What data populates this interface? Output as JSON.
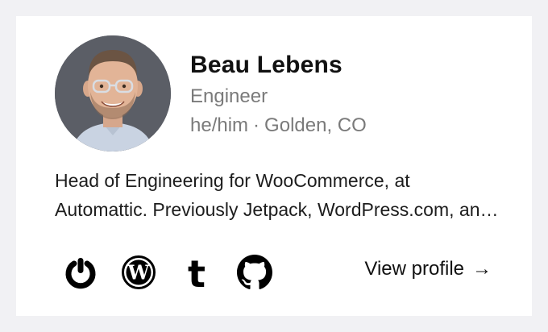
{
  "profile": {
    "name": "Beau Lebens",
    "title": "Engineer",
    "pronouns": "he/him",
    "separator": "·",
    "location": "Golden, CO",
    "bio": "Head of Engineering for WooCommerce, at Automattic. Previously Jetpack, WordPress.com, and more."
  },
  "social": [
    {
      "icon": "gravatar-icon"
    },
    {
      "icon": "wordpress-icon"
    },
    {
      "icon": "tumblr-icon"
    },
    {
      "icon": "github-icon"
    }
  ],
  "actions": {
    "view_profile_label": "View profile",
    "view_profile_arrow": "→"
  },
  "colors": {
    "page_background": "#f1f1f4",
    "card_background": "#ffffff",
    "name_text": "#111111",
    "muted_text": "#7a7a7a",
    "icon_color": "#000000"
  }
}
